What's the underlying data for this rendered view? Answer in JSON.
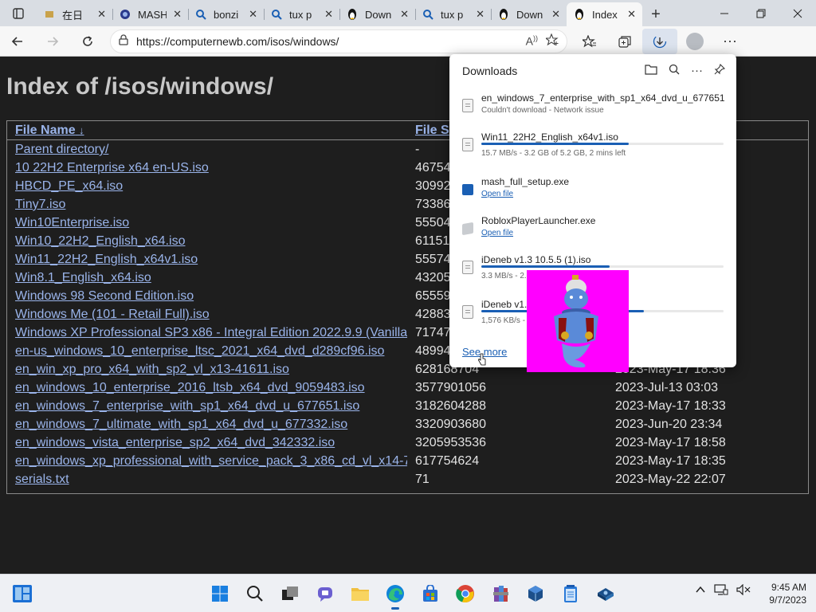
{
  "browser": {
    "tabs": [
      {
        "title": "在日",
        "favicon": "document-icon"
      },
      {
        "title": "MASH",
        "favicon": "mash-icon"
      },
      {
        "title": "bonzi",
        "favicon": "search-icon"
      },
      {
        "title": "tux p",
        "favicon": "search-icon"
      },
      {
        "title": "Down",
        "favicon": "tux-icon"
      },
      {
        "title": "tux p",
        "favicon": "search-icon"
      },
      {
        "title": "Down",
        "favicon": "tux-icon"
      },
      {
        "title": "Index",
        "favicon": "tux-icon",
        "active": true
      }
    ],
    "url": "https://computernewb.com/isos/windows/"
  },
  "page": {
    "title": "Index of /isos/windows/",
    "headers": {
      "name": "File Name",
      "sort_indicator": "↓",
      "size": "File S"
    },
    "rows": [
      {
        "name": "Parent directory/",
        "size": "-",
        "date": ""
      },
      {
        "name": "10 22H2 Enterprise x64 en-US.iso",
        "size": "46754",
        "date": ""
      },
      {
        "name": "HBCD_PE_x64.iso",
        "size": "30992",
        "date": ""
      },
      {
        "name": "Tiny7.iso",
        "size": "73386",
        "date": ""
      },
      {
        "name": "Win10Enterprise.iso",
        "size": "55504",
        "date": ""
      },
      {
        "name": "Win10_22H2_English_x64.iso",
        "size": "61151",
        "date": ""
      },
      {
        "name": "Win11_22H2_English_x64v1.iso",
        "size": "55574",
        "date": ""
      },
      {
        "name": "Win8.1_English_x64.iso",
        "size": "43205",
        "date": ""
      },
      {
        "name": "Windows 98 Second Edition.iso",
        "size": "65559",
        "date": ""
      },
      {
        "name": "Windows Me (101 - Retail Full).iso",
        "size": "42883",
        "date": ""
      },
      {
        "name": "Windows XP Professional SP3 x86 - Integral Edition 2022.9.9 (Vanilla",
        "size": "71747",
        "date": ""
      },
      {
        "name": "en-us_windows_10_enterprise_ltsc_2021_x64_dvd_d289cf96.iso",
        "size": "48994",
        "date": ""
      },
      {
        "name": "en_win_xp_pro_x64_with_sp2_vl_x13-41611.iso",
        "size": "628168704",
        "date": "2023-May-17 18:36"
      },
      {
        "name": "en_windows_10_enterprise_2016_ltsb_x64_dvd_9059483.iso",
        "size": "3577901056",
        "date": "2023-Jul-13 03:03"
      },
      {
        "name": "en_windows_7_enterprise_with_sp1_x64_dvd_u_677651.iso",
        "size": "3182604288",
        "date": "2023-May-17 18:33"
      },
      {
        "name": "en_windows_7_ultimate_with_sp1_x64_dvd_u_677332.iso",
        "size": "3320903680",
        "date": "2023-Jun-20 23:34"
      },
      {
        "name": "en_windows_vista_enterprise_sp2_x64_dvd_342332.iso",
        "size": "3205953536",
        "date": "2023-May-17 18:58"
      },
      {
        "name": "en_windows_xp_professional_with_service_pack_3_x86_cd_vl_x14-7",
        "size": "617754624",
        "date": "2023-May-17 18:35"
      },
      {
        "name": "serials.txt",
        "size": "71",
        "date": "2023-May-22 22:07"
      }
    ]
  },
  "downloads": {
    "title": "Downloads",
    "see_more": "See more",
    "items": [
      {
        "name": "en_windows_7_enterprise_with_sp1_x64_dvd_u_677651.i...",
        "status": "Couldn't download - Network issue"
      },
      {
        "name": "Win11_22H2_English_x64v1.iso",
        "status": "15.7 MB/s - 3.2 GB of 5.2 GB, 2 mins left",
        "progress": 0.61
      },
      {
        "name": "mash_full_setup.exe",
        "action": "Open file"
      },
      {
        "name": "RobloxPlayerLauncher.exe",
        "action": "Open file"
      },
      {
        "name": "iDeneb v1.3 10.5.5 (1).iso",
        "status": "3.3 MB/s - 2.",
        "progress": 0.53
      },
      {
        "name": "iDeneb v1.",
        "status": "1,576 KB/s - 1",
        "progress": 0.67
      }
    ]
  },
  "taskbar": {
    "time": "9:45 AM",
    "date": "9/7/2023",
    "colors": {
      "accent": "#1a5fb4",
      "genie_bg": "#ff00ff"
    }
  }
}
